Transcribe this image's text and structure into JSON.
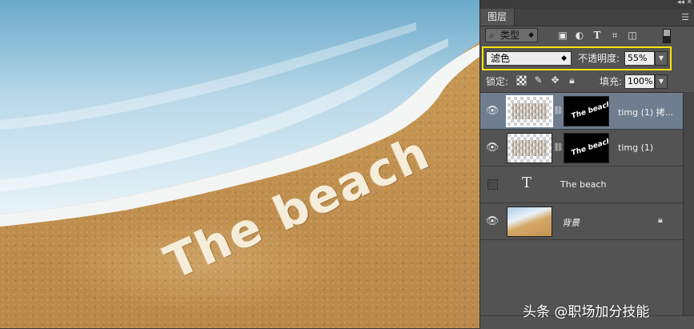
{
  "canvas": {
    "text": "The beach"
  },
  "panel": {
    "tab_label": "图层",
    "filter_label": "类型",
    "filter_icons": [
      "image-filter-icon",
      "adjustment-filter-icon",
      "type-filter-icon",
      "shape-filter-icon",
      "smart-object-filter-icon"
    ],
    "blend_mode": "滤色",
    "opacity_label": "不透明度:",
    "opacity_value": "55%",
    "lock_label": "锁定:",
    "fill_label": "填充:",
    "fill_value": "100%",
    "layers": [
      {
        "name": "timg (1) 拷...",
        "mask_text": "The beach",
        "selected": true,
        "visible": true
      },
      {
        "name": "timg (1)",
        "mask_text": "The beach",
        "selected": false,
        "visible": true
      },
      {
        "name": "The beach",
        "selected": false,
        "visible": false
      },
      {
        "name": "背景",
        "selected": false,
        "visible": true,
        "locked": true
      }
    ]
  },
  "watermark": "头条 @职场加分技能",
  "colors": {
    "highlight": "#ffe500",
    "panel_bg": "#535353",
    "selected_layer": "#6f7d8f"
  }
}
